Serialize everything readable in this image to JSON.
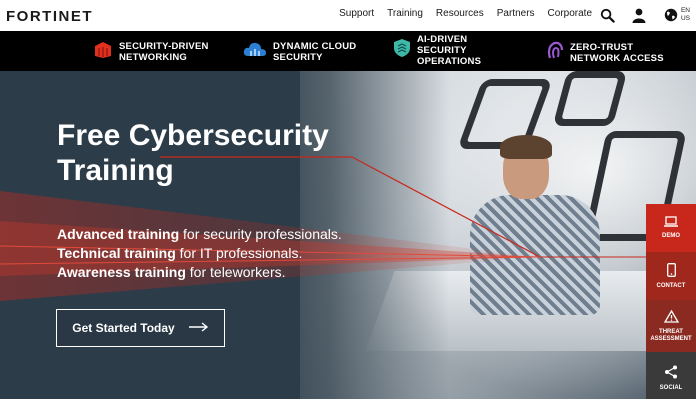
{
  "brand": {
    "logo_text": "FORTINET"
  },
  "nav": {
    "items": [
      "Support",
      "Training",
      "Resources",
      "Partners",
      "Corporate"
    ],
    "icons": [
      "search-icon",
      "user-icon",
      "globe-icon"
    ],
    "language": {
      "line1": "EN",
      "line2": "US"
    }
  },
  "solutions": [
    {
      "line1": "SECURITY-DRIVEN",
      "line2": "NETWORKING",
      "line3": "",
      "icon": "firewall-icon"
    },
    {
      "line1": "DYNAMIC CLOUD",
      "line2": "SECURITY",
      "line3": "",
      "icon": "cloud-icon"
    },
    {
      "line1": "AI-DRIVEN",
      "line2": "SECURITY",
      "line3": "OPERATIONS",
      "icon": "shield-icon"
    },
    {
      "line1": "ZERO-TRUST",
      "line2": "NETWORK ACCESS",
      "line3": "",
      "icon": "fingerprint-icon"
    }
  ],
  "hero": {
    "title_line1": "Free Cybersecurity",
    "title_line2": "Training",
    "lines": [
      {
        "bold": "Advanced training",
        "rest": " for security professionals."
      },
      {
        "bold": "Technical training",
        "rest": " for IT professionals."
      },
      {
        "bold": "Awareness training",
        "rest": " for teleworkers."
      }
    ],
    "cta_label": "Get Started Today"
  },
  "rail": [
    {
      "label": "DEMO",
      "icon": "laptop-icon"
    },
    {
      "label": "CONTACT",
      "icon": "phone-icon"
    },
    {
      "label": "THREAT ASSESSMENT",
      "icon": "warning-icon"
    },
    {
      "label": "SOCIAL",
      "icon": "share-icon"
    }
  ],
  "colors": {
    "brand_red": "#da291c",
    "hero_bg": "#2c3c48",
    "bar_bg": "#000000",
    "rail_demo": "#c8281b",
    "rail_social": "#3a3a3a"
  }
}
